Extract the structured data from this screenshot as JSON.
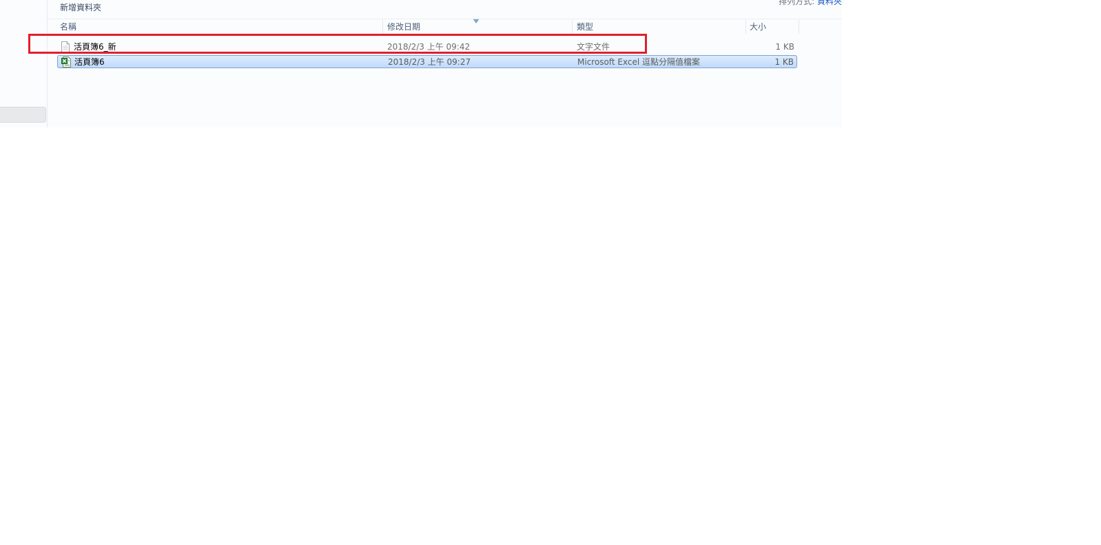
{
  "header": {
    "folder_title": "新增資料夾",
    "arrange_by_label": "排列方式:",
    "arrange_by_value": "資料夾"
  },
  "columns": {
    "name": "名稱",
    "date": "修改日期",
    "type": "類型",
    "size": "大小"
  },
  "files": [
    {
      "name": "活頁簿6_新",
      "date": "2018/2/3 上午 09:42",
      "type": "文字文件",
      "size": "1 KB",
      "icon": "text-file-icon",
      "selected": false
    },
    {
      "name": "活頁簿6",
      "date": "2018/2/3 上午 09:27",
      "type": "Microsoft Excel 逗點分隔值檔案",
      "size": "1 KB",
      "icon": "excel-csv-file-icon",
      "selected": true
    }
  ],
  "colors": {
    "highlight": "#e0202a",
    "selection": "#c1dbfc",
    "link": "#1d5ec5"
  }
}
